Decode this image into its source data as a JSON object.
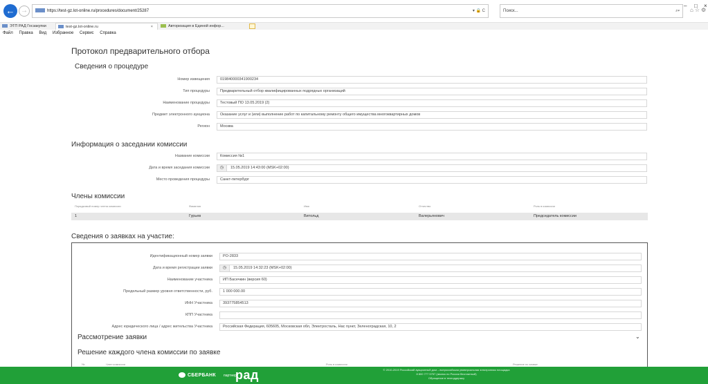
{
  "browser": {
    "url": "https://test-gz.lot-online.ru/procedures/document/25287",
    "url_icons": "▾ 🔒 C",
    "search_placeholder": "Поиск...",
    "search_icon": "⌕▾",
    "tabs": [
      {
        "label": "ЭТП РАД Госзакупки"
      },
      {
        "label": "test-gz.lot-online.ru",
        "close": "×"
      },
      {
        "label": "Авторизация в Единой инфор..."
      }
    ],
    "menu": [
      "Файл",
      "Правка",
      "Вид",
      "Избранное",
      "Сервис",
      "Справка"
    ],
    "window_controls": [
      "–",
      "□",
      "×"
    ]
  },
  "page": {
    "title": "Протокол предварительного отбора",
    "procedure": {
      "title": "Сведения о процедуре",
      "rows": [
        {
          "label": "Номер извещения",
          "value": "019840000341900234"
        },
        {
          "label": "Тип процедуры",
          "value": "Предварительный отбор квалифицированных подрядных организаций"
        },
        {
          "label": "Наименование процедуры",
          "value": "Тестовый ПО 13.05.2019 (2)"
        },
        {
          "label": "Предмет электронного аукциона",
          "value": "Оказание услуг и (или) выполнение работ по капитальному ремонту общего имущества многоквартирных домов"
        },
        {
          "label": "Регион",
          "value": "Москва"
        }
      ]
    },
    "meeting": {
      "title": "Информация о заседании комиссии",
      "rows": [
        {
          "label": "Название комиссии",
          "value": "Комиссия №1"
        },
        {
          "label": "Дата и время заседания комиссии",
          "value": "15.05.2019 14:43:00 (MSK+02:00)"
        },
        {
          "label": "Место проведения процедуры",
          "value": "Санкт-петербург"
        }
      ]
    },
    "members": {
      "title": "Члены комиссии",
      "headers": [
        "Порядковый номер члена комиссии",
        "Фамилия",
        "Имя",
        "Отчество",
        "Роль в комиссии"
      ],
      "rows": [
        [
          "1",
          "Гурьев",
          "Витольд",
          "Валерьянович",
          "Председатель комиссии"
        ]
      ]
    },
    "applications": {
      "title": "Сведения о заявках на участие:",
      "rows": [
        {
          "label": "Идентификационный номер заявки",
          "value": "PO-2833"
        },
        {
          "label": "Дата и время регистрации заявки",
          "value": "15.05.2019 14:32:23 (MSK+02:00)"
        },
        {
          "label": "Наименование участника",
          "value": "ИП Басечкин (версия 60)"
        },
        {
          "label": "Предельный размер уровня ответственности, руб.",
          "value": "1 000 000.00"
        },
        {
          "label": "ИНН Участника",
          "value": "393775854513"
        },
        {
          "label": "КПП Участника",
          "value": ""
        },
        {
          "label": "Адрес юридического лица / адрес жительства Участника",
          "value": "Российская Федерация, 605605, Московская обл, Электросталь, Нас пункт, Зеленоградская, 10, 2"
        }
      ],
      "review_title": "Рассмотрение заявки",
      "decision_title": "Решение каждого члена комиссии по заявке",
      "decision_headers": [
        "№",
        "Член комиссии",
        "Роль в комиссии",
        "Решение по заявке"
      ]
    }
  },
  "footer": {
    "sber": "СБЕРБАНК",
    "partner": "партнер",
    "rad": "рад",
    "lines": [
      "© 2010-2019 Российский аукционный дом – всероссийская универсальная электронная площадка",
      "8 800 777 5757 (звонок по России бесплатный)",
      "Обращение в техподдержку"
    ]
  }
}
